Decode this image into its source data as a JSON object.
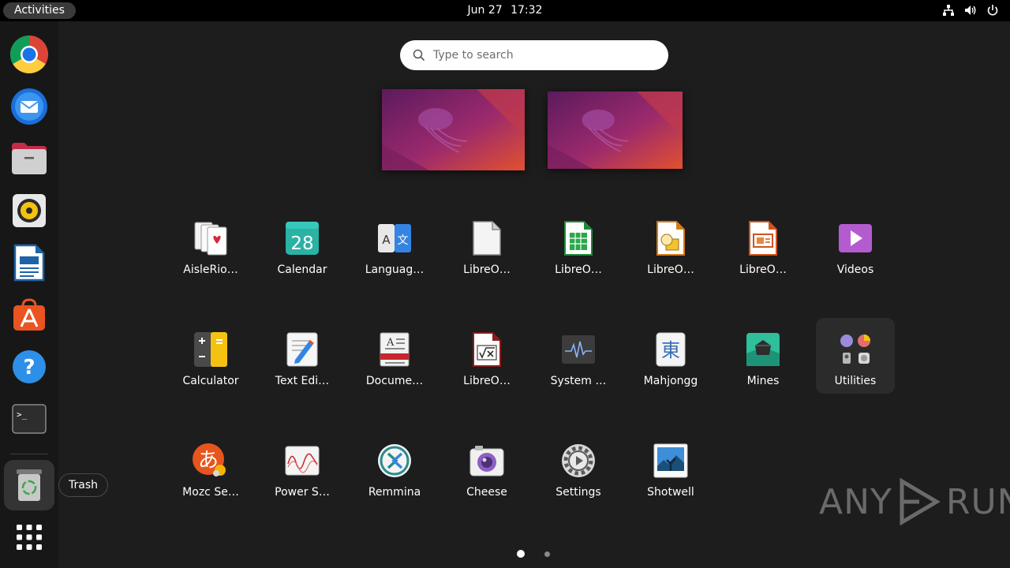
{
  "topbar": {
    "activities_label": "Activities",
    "date": "Jun 27",
    "time": "17:32",
    "icons": [
      "network-icon",
      "volume-icon",
      "power-icon"
    ]
  },
  "search": {
    "placeholder": "Type to search",
    "value": ""
  },
  "dock": {
    "items": [
      {
        "name": "chrome",
        "icon": "chrome-icon"
      },
      {
        "name": "thunderbird",
        "icon": "thunderbird-icon"
      },
      {
        "name": "files",
        "icon": "files-icon"
      },
      {
        "name": "rhythmbox",
        "icon": "rhythmbox-icon"
      },
      {
        "name": "libreoffice-writer",
        "icon": "writer-icon"
      },
      {
        "name": "app-center",
        "icon": "app-center-icon"
      },
      {
        "name": "help",
        "icon": "help-icon"
      },
      {
        "name": "terminal",
        "icon": "terminal-icon"
      },
      {
        "name": "trash",
        "icon": "trash-icon"
      },
      {
        "name": "show-apps",
        "icon": "app-grid-icon"
      }
    ],
    "tooltip": "Trash"
  },
  "apps": {
    "row1": [
      "AisleRio…",
      "Calendar",
      "Languag…",
      "LibreO…",
      "LibreO…",
      "LibreO…",
      "LibreO…",
      "Videos"
    ],
    "row2": [
      "Calculator",
      "Text Edi…",
      "Docume…",
      "LibreO…",
      "System …",
      "Mahjongg",
      "Mines",
      "Utilities"
    ],
    "row3": [
      "Mozc Se…",
      "Power S…",
      "Remmina",
      "Cheese",
      "Settings",
      "Shotwell"
    ]
  },
  "calendar_day": "28",
  "language_glyphs": {
    "left": "A",
    "right": "文"
  },
  "mahjongg_glyph": "東",
  "pager": {
    "pages": 2,
    "current": 1
  },
  "watermark": "ANY RUN",
  "watermark_parts": {
    "left": "ANY",
    "right": "RUN"
  },
  "colors": {
    "accent": "#e95420",
    "background": "#1d1d1d",
    "dock": "#171717"
  }
}
